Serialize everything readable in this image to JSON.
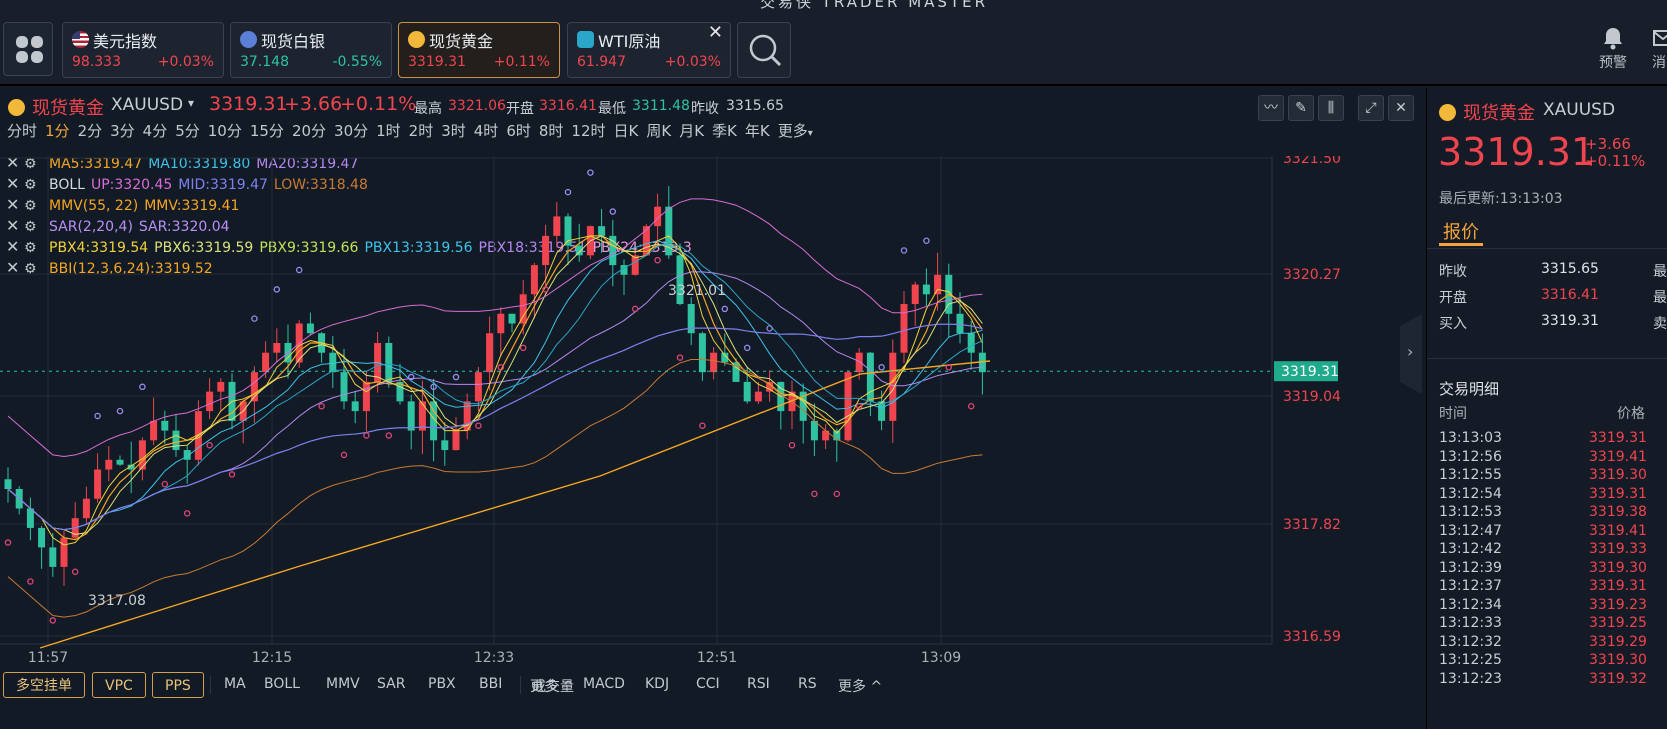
{
  "app": {
    "title": "交易侠 TRADER MASTER"
  },
  "quotes": [
    {
      "name": "美元指数",
      "price": "98.333",
      "change": "+0.03%",
      "dir": "up",
      "icon": "us-flag-icon"
    },
    {
      "name": "现货白银",
      "price": "37.148",
      "change": "-0.55%",
      "dir": "down",
      "icon": "silver-icon"
    },
    {
      "name": "现货黄金",
      "price": "3319.31",
      "change": "+0.11%",
      "dir": "up",
      "icon": "gold-icon",
      "active": true
    },
    {
      "name": "WTI原油",
      "price": "61.947",
      "change": "+0.03%",
      "dir": "up",
      "icon": "oil-icon"
    }
  ],
  "topright": {
    "alarm_label": "预警",
    "msg_label": "消"
  },
  "instrument": {
    "name": "现货黄金",
    "code": "XAUUSD",
    "price": "3319.31",
    "change": "+3.66",
    "pct": "+0.11%",
    "high_label": "最高",
    "high": "3321.06",
    "open_label": "开盘",
    "open": "3316.41",
    "low_label": "最低",
    "low": "3311.48",
    "prev_label": "昨收",
    "prev": "3315.65"
  },
  "timeframes": [
    "分时",
    "1分",
    "2分",
    "3分",
    "4分",
    "5分",
    "10分",
    "15分",
    "20分",
    "30分",
    "1时",
    "2时",
    "3时",
    "4时",
    "6时",
    "8时",
    "12时",
    "日K",
    "周K",
    "月K",
    "季K",
    "年K",
    "更多"
  ],
  "active_tf": "1分",
  "indicators": [
    [
      {
        "t": "MA5:3319.47",
        "c": "#f5a623"
      },
      {
        "t": "MA10:3319.80",
        "c": "#3dc2e8"
      },
      {
        "t": "MA20:3319.47",
        "c": "#b687f0"
      }
    ],
    [
      {
        "t": "BOLL",
        "c": "#d5d9de"
      },
      {
        "t": "UP:3320.45",
        "c": "#d86cd6"
      },
      {
        "t": "MID:3319.47",
        "c": "#7e80f0"
      },
      {
        "t": "LOW:3318.48",
        "c": "#c97a35"
      }
    ],
    [
      {
        "t": "MMV(55, 22)",
        "c": "#f5a623"
      },
      {
        "t": "MMV:3319.41",
        "c": "#f5a623"
      }
    ],
    [
      {
        "t": "SAR(2,20,4)",
        "c": "#b890f5"
      },
      {
        "t": "SAR:3320.04",
        "c": "#b890f5"
      }
    ],
    [
      {
        "t": "PBX4:3319.54",
        "c": "#f0d23c"
      },
      {
        "t": "PBX6:3319.59",
        "c": "#d9e27a"
      },
      {
        "t": "PBX9:3319.66",
        "c": "#c6e05a"
      },
      {
        "t": "PBX13:3319.56",
        "c": "#3dc2e8"
      },
      {
        "t": "PBX18:3319.51",
        "c": "#b687f0"
      },
      {
        "t": "PBX24:3319.3",
        "c": "#e896e0"
      }
    ],
    [
      {
        "t": "BBI(12,3,6,24):3319.52",
        "c": "#f5a623"
      }
    ]
  ],
  "chart_data": {
    "type": "candlestick",
    "y_ticks": [
      "3321.50",
      "3320.27",
      "3319.04",
      "3317.82",
      "3316.59"
    ],
    "x_ticks": [
      "11:57",
      "12:15",
      "12:33",
      "12:51",
      "13:09"
    ],
    "current_price": "3319.31",
    "annotations": {
      "high": "3321.01",
      "low": "3317.08"
    },
    "ylim": [
      3316.59,
      3321.5
    ]
  },
  "bottom": {
    "buttons": [
      "多空挂单",
      "VPC",
      "PPS"
    ],
    "main_ind": [
      "MA",
      "BOLL",
      "MMV",
      "SAR",
      "PBX",
      "BBI",
      "更多 ^"
    ],
    "sub_ind": [
      "成交量",
      "MACD",
      "KDJ",
      "CCI",
      "RSI",
      "RS",
      "更多 ^"
    ]
  },
  "right": {
    "name": "现货黄金",
    "code": "XAUUSD",
    "price": "3319.31",
    "change": "+3.66",
    "pct": "+0.11%",
    "updated": "最后更新:13:13:03",
    "tab": "报价",
    "rows": [
      {
        "label": "昨收",
        "value": "3315.65",
        "dir": "flat",
        "r": "最"
      },
      {
        "label": "开盘",
        "value": "3316.41",
        "dir": "up",
        "r": "最"
      },
      {
        "label": "买入",
        "value": "3319.31",
        "dir": "flat",
        "r": "卖"
      }
    ],
    "trades_title": "交易明细",
    "col_time": "时间",
    "col_price": "价格",
    "trades": [
      [
        "13:13:03",
        "3319.31"
      ],
      [
        "13:12:56",
        "3319.41"
      ],
      [
        "13:12:55",
        "3319.30"
      ],
      [
        "13:12:54",
        "3319.31"
      ],
      [
        "13:12:53",
        "3319.38"
      ],
      [
        "13:12:47",
        "3319.41"
      ],
      [
        "13:12:42",
        "3319.33"
      ],
      [
        "13:12:39",
        "3319.30"
      ],
      [
        "13:12:37",
        "3319.31"
      ],
      [
        "13:12:34",
        "3319.23"
      ],
      [
        "13:12:33",
        "3319.25"
      ],
      [
        "13:12:32",
        "3319.29"
      ],
      [
        "13:12:25",
        "3319.30"
      ],
      [
        "13:12:23",
        "3319.32"
      ]
    ]
  }
}
